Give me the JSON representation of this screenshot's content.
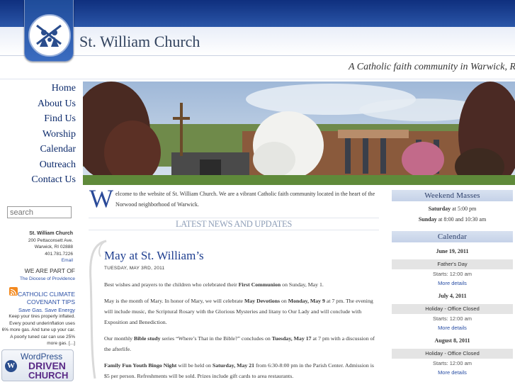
{
  "header": {
    "site_title": "St. William Church",
    "tagline": "A Catholic faith community in Warwick, RI"
  },
  "nav": {
    "items": [
      {
        "label": "Home"
      },
      {
        "label": "About Us"
      },
      {
        "label": "Find Us"
      },
      {
        "label": "Worship"
      },
      {
        "label": "Calendar"
      },
      {
        "label": "Outreach"
      },
      {
        "label": "Contact Us"
      }
    ]
  },
  "search": {
    "placeholder": "search"
  },
  "contact": {
    "name": "St. William Church",
    "address1": "200 Pettaconsett Ave.",
    "address2": "Warwick, RI 02888",
    "phone": "401.781.7226",
    "email_label": "Email"
  },
  "part_of": {
    "heading": "WE ARE PART OF",
    "link": "The Diocese of Providence"
  },
  "climate": {
    "heading": "CATHOLIC CLIMATE COVENANT TIPS",
    "subheading": "Save Gas. Save Energy",
    "body": "Keep your tires properly inflated. Every pound underinflation uses 6% more gas. And tune up your car. A poorly tuned car can use 25% more gas. [...]"
  },
  "wp_badge": {
    "line1": "WordPress",
    "line2": "DRIVEN",
    "line3": "CHURCH",
    "logo_letter": "W"
  },
  "welcome": {
    "drop_cap": "W",
    "text": "elcome to the website of St. William Church. We are a vibrant Catholic faith community located in the heart of the Norwood neighborhood of Warwick."
  },
  "news": {
    "heading": "LATEST NEWS AND UPDATES",
    "post": {
      "title": "May at St. William’s",
      "date": "TUESDAY, MAY 3RD, 2011",
      "p1": {
        "a": "Best wishes and prayers to the children who celebrated their ",
        "b": "First Communion",
        "c": " on Sunday, May 1."
      },
      "p2": {
        "a": "May is the month of Mary. In honor of Mary, we will celebrate ",
        "b": "May Devotions",
        "c": " on ",
        "d": "Monday, May 9",
        "e": " at 7 pm. The evening will include music, the Scriptural Rosary with the Glorious Mysteries and litany to Our Lady and will conclude with Exposition and Benediction."
      },
      "p3": {
        "a": "Our monthly ",
        "b": "Bible study",
        "c": " series “Where’s That in the Bible?” concludes on ",
        "d": "Tuesday, May 17",
        "e": " at 7 pm with a discussion of the afterlife."
      },
      "p4": {
        "a": "Family Fun Youth Bingo Night",
        "b": " will be held on ",
        "c": "Saturday, May 21",
        "d": " from 6:30-8:00 pm in the Parish Center.  Admission is $5 per person.  Refreshments will be sold.  Prizes include gift cards to area restaurants."
      }
    }
  },
  "weekend_masses": {
    "heading": "Weekend Masses",
    "lines": [
      {
        "day": "Saturday",
        "time": " at 5:00 pm"
      },
      {
        "day": "Sunday",
        "time": " at 8:00 and 10:30 am"
      }
    ]
  },
  "calendar": {
    "heading": "Calendar",
    "events": [
      {
        "date": "June 19, 2011",
        "title": "Father's Day",
        "starts": "Starts: 12:00 am",
        "more": "More details"
      },
      {
        "date": "July 4, 2011",
        "title": "Holiday - Office Closed",
        "starts": "Starts: 12:00 am",
        "more": "More details"
      },
      {
        "date": "August 8, 2011",
        "title": "Holiday - Office Closed",
        "starts": "Starts: 12:00 am",
        "more": "More details"
      }
    ]
  },
  "colors": {
    "header_blue": "#1a3f8f",
    "link_blue": "#2a4fa5",
    "title_blue": "#1d3d8f",
    "rss_orange": "#f3891f"
  }
}
